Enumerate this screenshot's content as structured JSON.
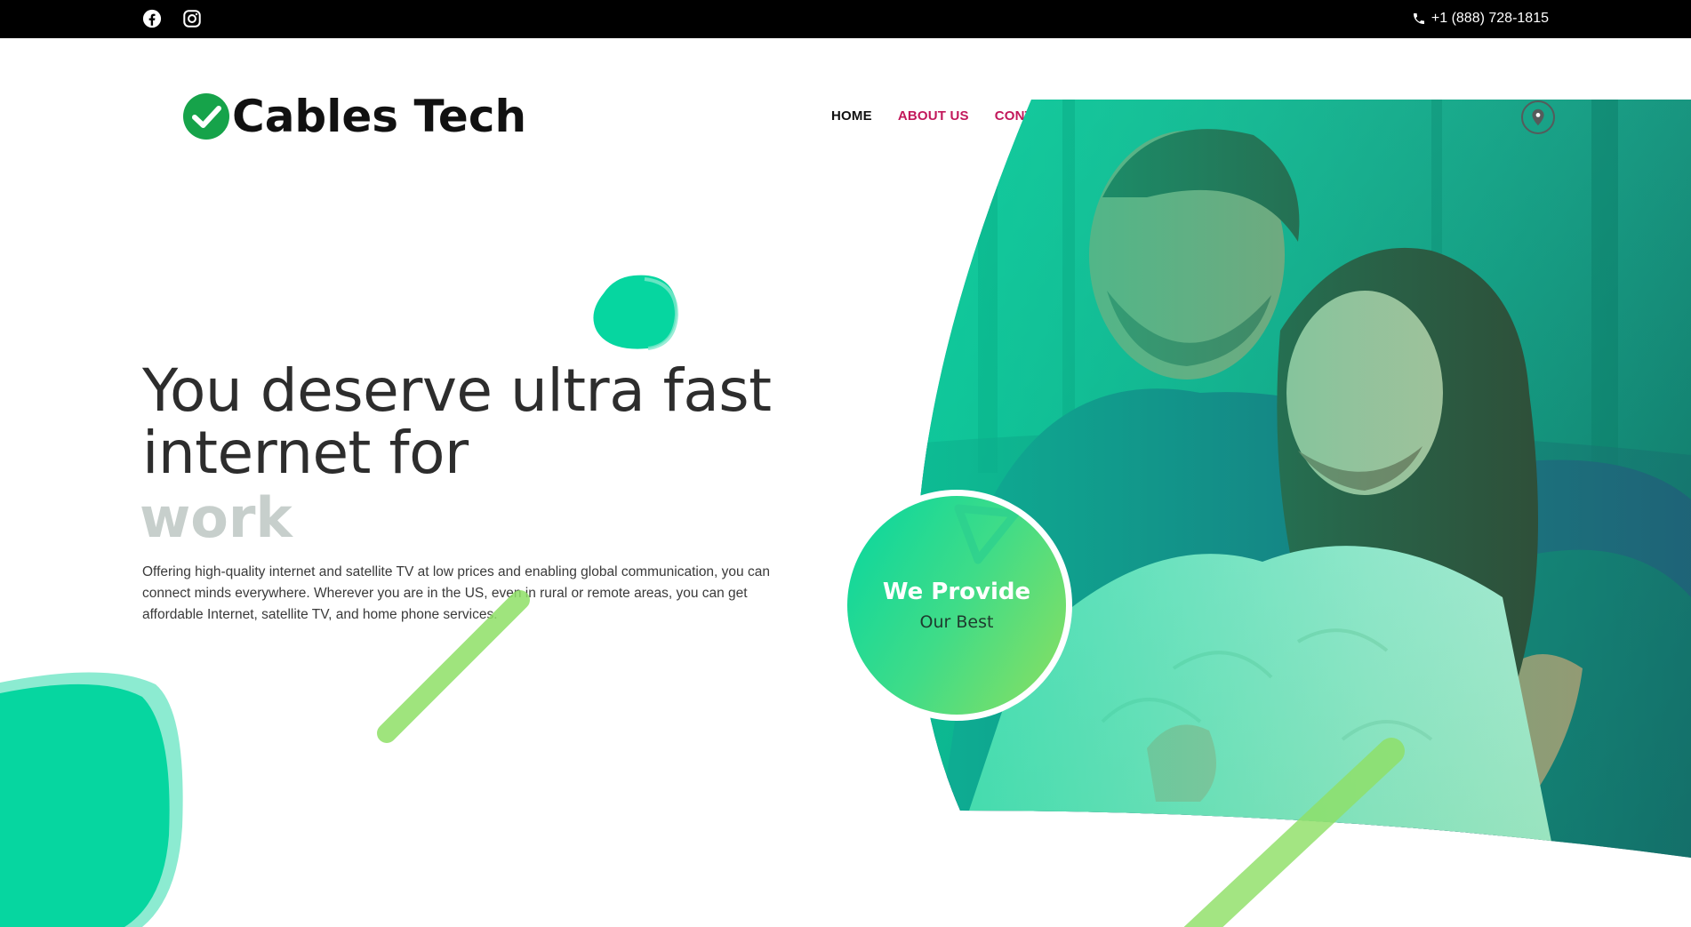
{
  "topbar": {
    "phone": "+1 (888) 728-1815",
    "icons": [
      "facebook-icon",
      "instagram-icon",
      "phone-icon"
    ]
  },
  "header": {
    "logo_text": "Cables Tech",
    "nav": [
      {
        "label": "HOME",
        "active": true
      },
      {
        "label": "ABOUT US",
        "active": false
      },
      {
        "label": "CONTACT US",
        "active": false
      }
    ],
    "map_icon": "map-pin-icon"
  },
  "hero": {
    "headline": "You deserve ultra fast internet for",
    "rotating_word": "work",
    "description": "Offering high-quality internet and satellite TV at low prices and enabling global communication, you can connect minds everywhere. Wherever you are in the US, even in rural or remote areas, you can get affordable Internet, satellite TV, and home phone services."
  },
  "badge": {
    "title": "We Provide",
    "subtitle": "Our Best"
  },
  "colors": {
    "brand_green": "#06D6A0",
    "lime": "#8FE067",
    "nav_pink": "#C2185B",
    "topbar": "#000000",
    "headline": "#2D2D2D",
    "rotating_word": "#C7CFCC"
  }
}
